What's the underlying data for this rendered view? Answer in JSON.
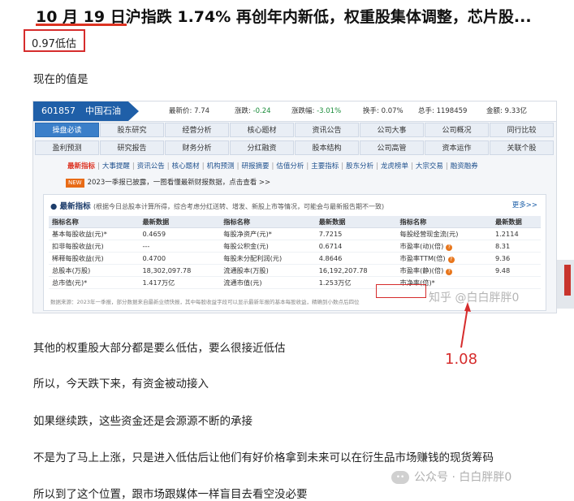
{
  "headline": {
    "date": "10 月 19 日",
    "text": "沪指跌 1.74% 再创年内新低，权重股集体调整，芯片股..."
  },
  "boxed_note": "0.97低估",
  "paragraphs": [
    "现在的值是",
    "其他的权重股大部分都是要么低估，要么很接近低估",
    "所以，今天跌下来，有资金被动接入",
    "如果继续跌，这些资金还是会源源不断的承接",
    "不是为了马上上涨，只是进入低估后让他们有好价格拿到未来可以在衍生品市场赚钱的现货筹码",
    "所以到了这个位置，跟市场跟媒体一样盲目去看空没必要"
  ],
  "stock": {
    "code": "601857",
    "name": "中国石油",
    "quotes": [
      {
        "label": "最新价:",
        "value": "7.74"
      },
      {
        "label": "涨跌:",
        "value": "-0.24"
      },
      {
        "label": "涨跌幅:",
        "value": "-3.01%"
      },
      {
        "label": "换手:",
        "value": "0.07%"
      },
      {
        "label": "总手:",
        "value": "1198459"
      },
      {
        "label": "金额:",
        "value": "9.33亿"
      }
    ]
  },
  "nav_row1": [
    "操盘必读",
    "股东研究",
    "经营分析",
    "核心题材",
    "资讯公告",
    "公司大事",
    "公司概况",
    "同行比较"
  ],
  "nav_row2": [
    "盈利预测",
    "研究报告",
    "财务分析",
    "分红融资",
    "股本结构",
    "公司高管",
    "资本运作",
    "关联个股"
  ],
  "subnav": [
    "最新指标",
    "大事提醒",
    "资讯公告",
    "核心题材",
    "机构预测",
    "研报摘要",
    "估值分析",
    "主要指标",
    "股东分析",
    "龙虎榜单",
    "大宗交易",
    "融资融券"
  ],
  "notice": {
    "tag": "NEW",
    "text": "2023一季报已披露，一图看懂最新财报数据，点击查看 >>"
  },
  "panel": {
    "title": "最新指标",
    "subtitle": "(根据今日总股本计算所得，综合考虑分红送转、增发、新股上市等情况，可能会与最新报告期不一致)",
    "more": "更多>>",
    "headers": [
      "指标名称",
      "最新数据",
      "指标名称",
      "最新数据",
      "指标名称",
      "最新数据"
    ],
    "rows": [
      [
        "基本每股收益(元)*",
        "0.4659",
        "每股净资产(元)*",
        "7.7215",
        "每股经营现金流(元)",
        "1.2114"
      ],
      [
        "扣非每股收益(元)",
        "---",
        "每股公积金(元)",
        "0.6714",
        "市盈率(动)(倍)",
        "8.31"
      ],
      [
        "稀释每股收益(元)",
        "0.4700",
        "每股未分配利润(元)",
        "4.8646",
        "市盈率TTM(倍)",
        "9.36"
      ],
      [
        "总股本(万股)",
        "18,302,097.78",
        "流通股本(万股)",
        "16,192,207.78",
        "市盈率(静)(倍)",
        "9.48"
      ],
      [
        "总市值(元)*",
        "1.417万亿",
        "流通市值(元)",
        "1.253万亿",
        "市净率(倍)*",
        ""
      ]
    ],
    "footnote": "数据来源：2023年一季报，部分数据来自最新业绩快报，其中每股收益字段可以显示最新年报的基本每股收益，精确到小数点后四位"
  },
  "watermark_1": "知乎 @白白胖胖0",
  "annotation_value": "1.08",
  "watermark_2": "公众号 · 白白胖胖0",
  "colors": {
    "accent_red": "#d62c2c",
    "brand_blue": "#1f5fa8"
  }
}
